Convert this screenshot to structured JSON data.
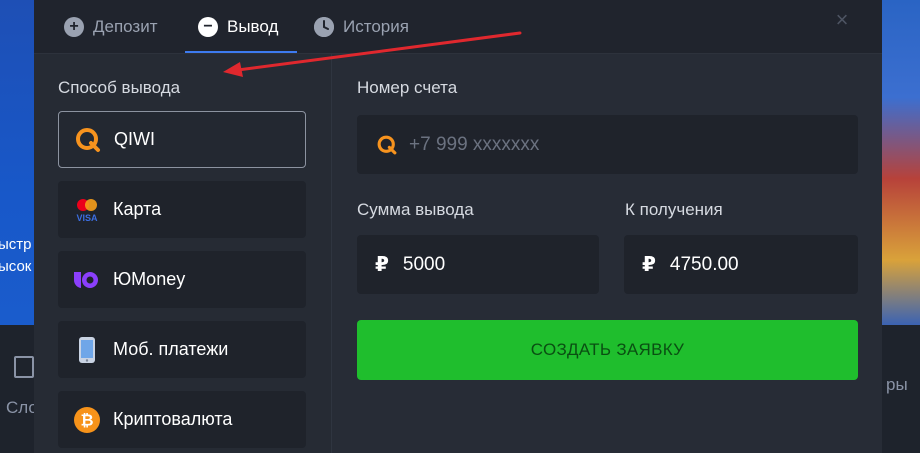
{
  "background": {
    "left_line_1": "ыстр",
    "left_line_2": "ысок",
    "nav_left": "Сло",
    "nav_right": "ры"
  },
  "tabs": [
    {
      "label": "Депозит",
      "icon": "plus-circle-icon",
      "active": false
    },
    {
      "label": "Вывод",
      "icon": "minus-circle-icon",
      "active": true
    },
    {
      "label": "История",
      "icon": "clock-icon",
      "active": false
    }
  ],
  "close_icon": "close-icon",
  "withdraw": {
    "method_label": "Способ вывода",
    "methods": [
      {
        "label": "QIWI",
        "icon": "qiwi-icon",
        "selected": true
      },
      {
        "label": "Карта",
        "icon": "mastercard-visa-icon",
        "selected": false
      },
      {
        "label": "ЮMoney",
        "icon": "yoomoney-icon",
        "selected": false
      },
      {
        "label": "Моб. платежи",
        "icon": "mobile-phone-icon",
        "selected": false
      },
      {
        "label": "Криптовалюта",
        "icon": "bitcoin-icon",
        "selected": false
      }
    ],
    "account_label": "Номер счета",
    "account_placeholder": "+7 999 xxxxxxx",
    "amount_label": "Сумма вывода",
    "amount_currency": "₽",
    "amount_value": "5000",
    "receive_label": "К получения",
    "receive_currency": "₽",
    "receive_value": "4750.00",
    "submit_label": "СОЗДАТЬ ЗАЯВКУ"
  },
  "colors": {
    "accent_blue": "#3d7bf0",
    "submit_green": "#1fbe2d",
    "annotation_red": "#e0282e"
  }
}
